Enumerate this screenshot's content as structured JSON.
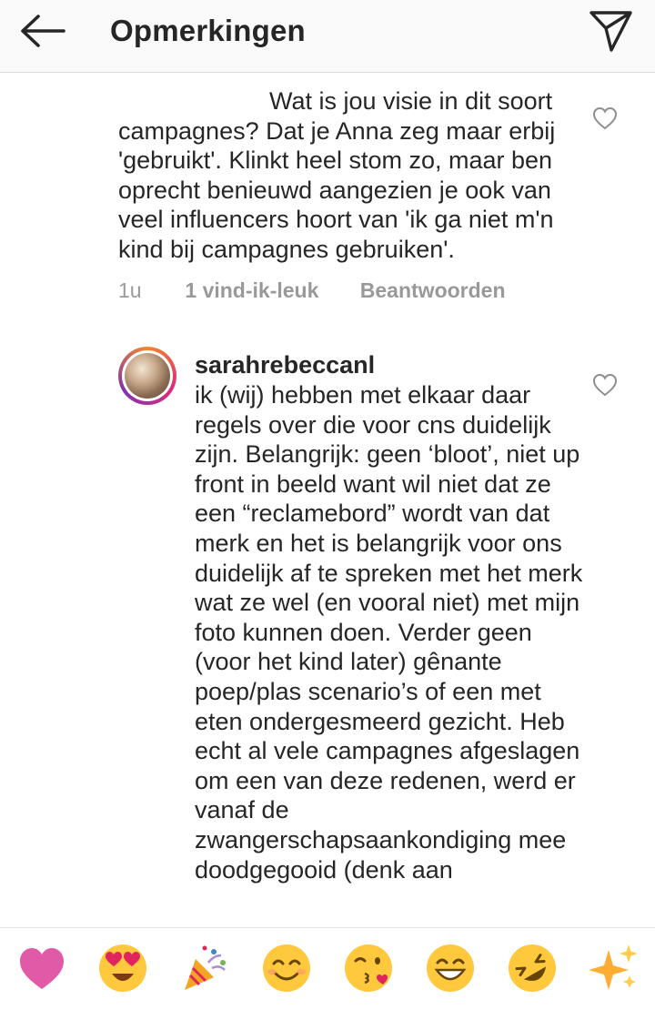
{
  "header": {
    "title": "Opmerkingen",
    "back_icon": "arrow-left-icon",
    "send_icon": "paper-plane-icon"
  },
  "comments": [
    {
      "text": "Wat is jou visie in dit soort campagnes? Dat je Anna zeg maar erbij 'gebruikt'. Klinkt heel stom zo, maar ben oprecht benieuwd aangezien je ook van veel influencers hoort van 'ik ga niet m'n kind bij campagnes gebruiken'.",
      "time": "1u",
      "likes": "1 vind-ik-leuk",
      "reply": "Beantwoorden"
    },
    {
      "username": "sarahrebeccanl",
      "text": "ik (wij) hebben met elkaar daar regels over die voor cns duidelijk zijn. Belangrijk: geen ‘bloot’, niet up front in beeld want wil niet dat ze een “reclamebord” wordt van dat merk en het is belangrijk voor ons duidelijk af te spreken met het merk wat ze wel (en vooral niet) met mijn foto kunnen doen. Verder geen (voor het kind later) gênante poep/plas scenario’s of een met eten ondergesmeerd gezicht. Heb echt al vele campagnes afgeslagen om een van deze redenen, werd er vanaf de zwangerschapsaankondiging mee doodgegooid (denk aan"
    }
  ],
  "emoji_bar": [
    "heart",
    "heart-eyes",
    "party-popper",
    "smiling-face",
    "kissing-face",
    "grinning-face",
    "rofl-face",
    "sparkles"
  ],
  "colors": {
    "text": "#262626",
    "meta": "#999999",
    "heart": "#e05aa8",
    "emoji_yellow": "#ffc83d"
  }
}
